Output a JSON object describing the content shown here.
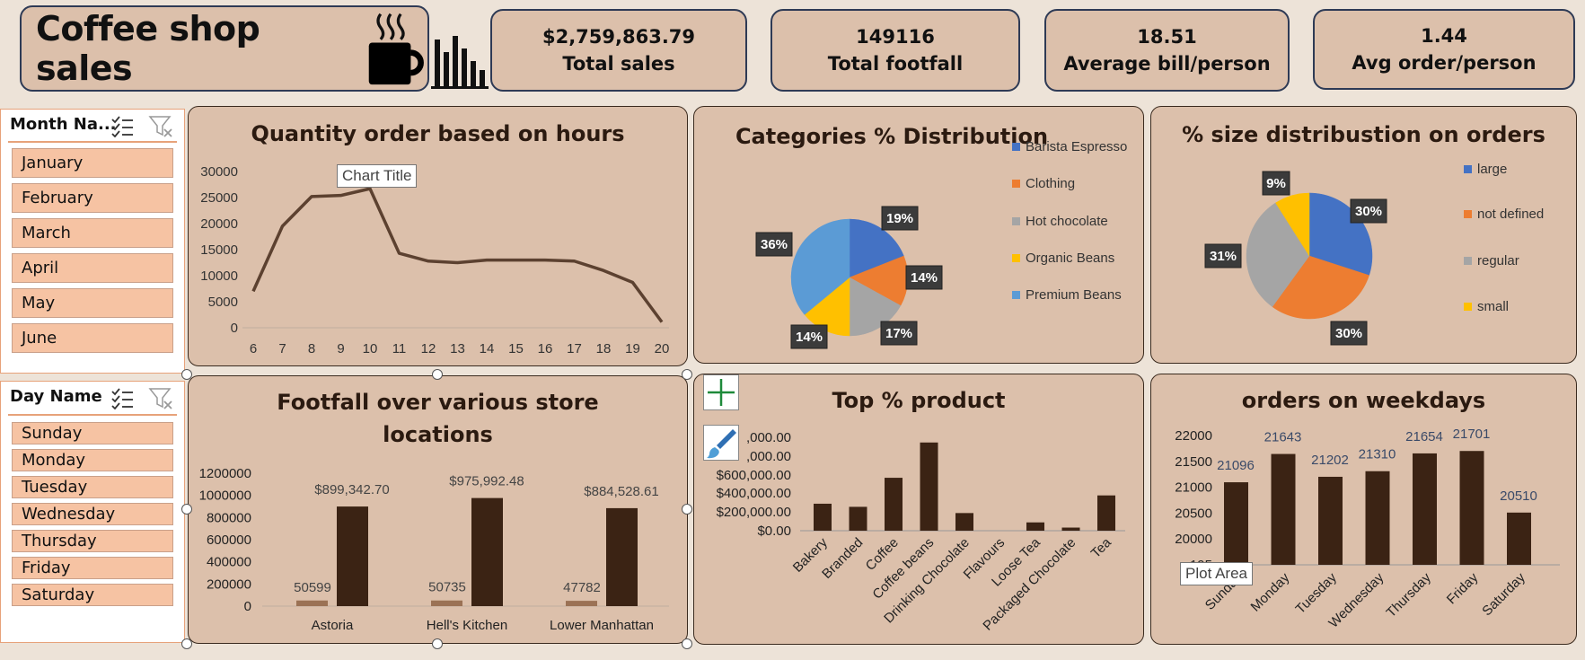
{
  "header": {
    "title": "Coffee shop sales",
    "kpis": [
      {
        "value": "$2,759,863.79",
        "label": "Total sales"
      },
      {
        "value": "149116",
        "label": "Total footfall"
      },
      {
        "value": "18.51",
        "label": "Average bill/person"
      },
      {
        "value": "1.44",
        "label": "Avg order/person"
      }
    ]
  },
  "slicers": {
    "month": {
      "title": "Month Na...",
      "items": [
        "January",
        "February",
        "March",
        "April",
        "May",
        "June"
      ]
    },
    "day": {
      "title": "Day Name",
      "items": [
        "Sunday",
        "Monday",
        "Tuesday",
        "Wednesday",
        "Thursday",
        "Friday",
        "Saturday"
      ]
    }
  },
  "tooltips": {
    "chart_title": "Chart Title",
    "plot_area": "Plot Area"
  },
  "icons": [
    "coffee-cup-icon",
    "bar-chart-icon",
    "multi-select-icon",
    "clear-filter-icon",
    "add-chart-element-icon",
    "chart-styles-icon"
  ],
  "colors": {
    "panel_bg": "#dcc0ab",
    "dark_bar": "#3b2314",
    "light_bar": "#9b7255",
    "line": "#5c4130",
    "pie_blue": "#4472c4",
    "pie_orange": "#ed7d31",
    "pie_gray": "#a5a5a5",
    "pie_yellow": "#ffc000",
    "pie_lightblue": "#5b9bd5"
  },
  "chart_data": [
    {
      "type": "line",
      "title": "Quantity order based on hours",
      "x": [
        6,
        7,
        8,
        9,
        10,
        11,
        12,
        13,
        14,
        15,
        16,
        17,
        18,
        19,
        20
      ],
      "values": [
        7000,
        19500,
        25200,
        25400,
        26700,
        14300,
        12800,
        12500,
        13000,
        13000,
        13000,
        12800,
        11000,
        8700,
        1100
      ],
      "ylim": [
        0,
        30000
      ],
      "yticks": [
        "30000",
        "25000",
        "20000",
        "15000",
        "10000",
        "5000",
        "0"
      ]
    },
    {
      "type": "pie",
      "title": "Categories % Distribution",
      "labels": [
        "Barista Espresso",
        "Clothing",
        "Hot chocolate",
        "Organic Beans",
        "Premium Beans"
      ],
      "values": [
        19,
        14,
        17,
        14,
        36
      ],
      "data_labels": [
        "19%",
        "14%",
        "17%",
        "14%",
        "36%"
      ]
    },
    {
      "type": "pie",
      "title": "% size distribustion on orders",
      "labels": [
        "large",
        "not defined",
        "regular",
        "small"
      ],
      "values": [
        30,
        30,
        31,
        9
      ],
      "data_labels": [
        "30%",
        "30%",
        "31%",
        "9%"
      ]
    },
    {
      "type": "bar",
      "title": "Footfall over various store locations",
      "title_lines": [
        "Footfall over various store",
        "locations"
      ],
      "categories": [
        "Astoria",
        "Hell's Kitchen",
        "Lower Manhattan"
      ],
      "series": [
        {
          "values": [
            50599,
            50735,
            47782
          ],
          "labels": [
            "50599",
            "50735",
            "47782"
          ]
        },
        {
          "values": [
            899342.7,
            975992.48,
            884528.61
          ],
          "labels": [
            "$899,342.70",
            "$975,992.48",
            "$884,528.61"
          ]
        }
      ],
      "ylim": [
        0,
        1200000
      ],
      "yticks": [
        "1200000",
        "1000000",
        "800000",
        "600000",
        "400000",
        "200000",
        "0"
      ]
    },
    {
      "type": "bar",
      "title": "Top % product",
      "categories": [
        "Bakery",
        "Branded",
        "Coffee",
        "Coffee beans",
        "Drinking Chocolate",
        "Flavours",
        "Loose Tea",
        "Packaged Chocolate",
        "Tea"
      ],
      "values": [
        260000,
        230000,
        510000,
        850000,
        170000,
        0,
        80000,
        30000,
        340000
      ],
      "ylim": [
        0,
        900000
      ],
      "yticks": [
        ",000.00",
        ",000.00",
        "$600,000.00",
        "$400,000.00",
        "$200,000.00",
        "$0.00"
      ]
    },
    {
      "type": "bar",
      "title": "orders on weekdays",
      "categories": [
        "Sunday",
        "Monday",
        "Tuesday",
        "Wednesday",
        "Thursday",
        "Friday",
        "Saturday"
      ],
      "values": [
        21096,
        21643,
        21202,
        21310,
        21654,
        21701,
        20510
      ],
      "labels": [
        "21096",
        "21643",
        "21202",
        "21310",
        "21654",
        "21701",
        "20510"
      ],
      "ylim": [
        19500,
        22000
      ],
      "yticks": [
        "22000",
        "21500",
        "21000",
        "20500",
        "20000",
        "195"
      ]
    }
  ]
}
